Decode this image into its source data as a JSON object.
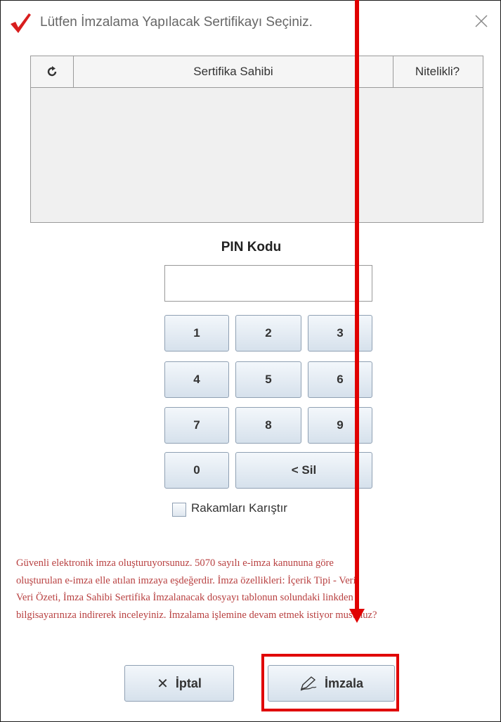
{
  "window": {
    "title": "Lütfen İmzalama Yapılacak Sertifikayı Seçiniz.",
    "close_symbol": "✕"
  },
  "certificate_table": {
    "refresh_icon": "refresh-icon",
    "columns": [
      "Sertifika Sahibi",
      "Nitelikli?"
    ],
    "rows": []
  },
  "pin": {
    "label": "PIN Kodu",
    "value": ""
  },
  "keypad": {
    "keys": [
      "1",
      "2",
      "3",
      "4",
      "5",
      "6",
      "7",
      "8",
      "9",
      "0"
    ],
    "delete_label": "< Sil"
  },
  "shuffle": {
    "label": "Rakamları Karıştır",
    "checked": false
  },
  "warning_text": [
    "Güvenli elektronik imza oluşturuyorsunuz. 5070 sayılı e-imza kanununa göre",
    "oluşturulan e-imza elle atılan imzaya eşdeğerdir. İmza özellikleri: İçerik Tipi - Veri,",
    "Veri Özeti, İmza Sahibi Sertifika İmzalanacak dosyayı tablonun solundaki linkden",
    "bilgisayarınıza indirerek inceleyiniz. İmzalama işlemine devam etmek istiyor musunuz?"
  ],
  "buttons": {
    "cancel_label": "İptal",
    "sign_label": "İmzala"
  },
  "colors": {
    "annotation": "#e00000",
    "warning_text": "#b84040",
    "app_icon": "#d81e1e"
  }
}
